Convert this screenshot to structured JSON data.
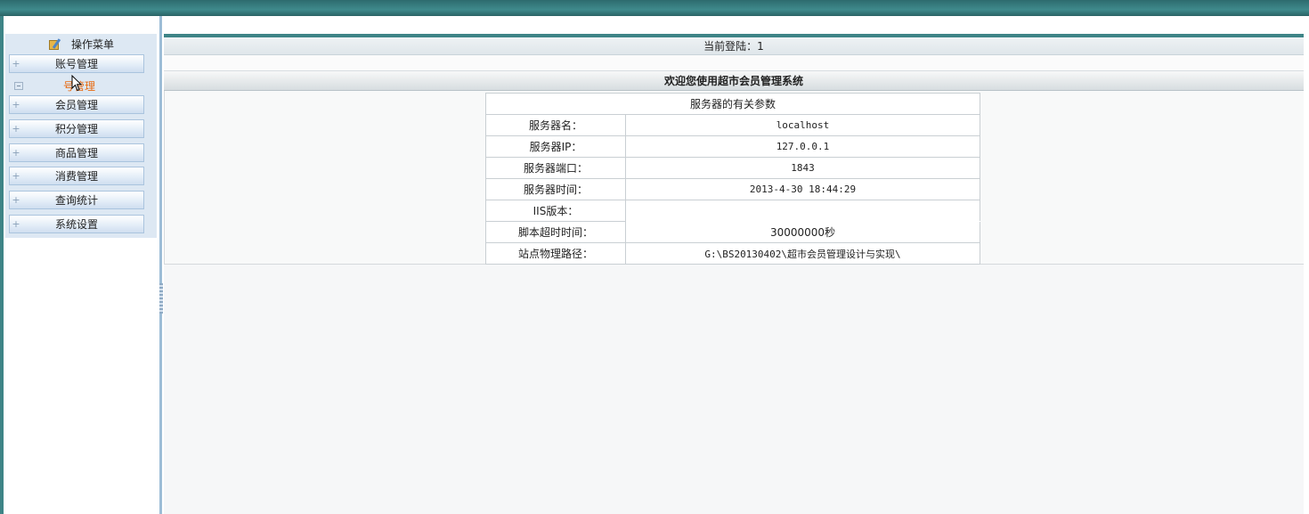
{
  "sidebar": {
    "header": "操作菜单",
    "items": [
      {
        "label": "账号管理",
        "active": false
      },
      {
        "label": "号管理",
        "active": true
      },
      {
        "label": "会员管理",
        "active": false
      },
      {
        "label": "积分管理",
        "active": false
      },
      {
        "label": "商品管理",
        "active": false
      },
      {
        "label": "消费管理",
        "active": false
      },
      {
        "label": "查询统计",
        "active": false
      },
      {
        "label": "系统设置",
        "active": false
      }
    ]
  },
  "main": {
    "login_text": "当前登陆：1",
    "welcome_text": "欢迎您使用超市会员管理系统",
    "table": {
      "caption": "服务器的有关参数",
      "rows": [
        {
          "key": "服务器名：",
          "value": "localhost"
        },
        {
          "key": "服务器IP：",
          "value": "127.0.0.1"
        },
        {
          "key": "服务器端口：",
          "value": "1843"
        },
        {
          "key": "服务器时间：",
          "value": "2013-4-30 18:44:29"
        },
        {
          "key": "IIS版本：",
          "value": ""
        },
        {
          "key": "脚本超时时间：",
          "value": "30000000秒"
        },
        {
          "key": "站点物理路径：",
          "value": "G:\\BS20130402\\超市会员管理设计与实现\\"
        }
      ]
    }
  },
  "colors": {
    "top_bar": "#3f8a8c",
    "menu_panel": "#dde8f3",
    "active_item": "#e86a10"
  }
}
